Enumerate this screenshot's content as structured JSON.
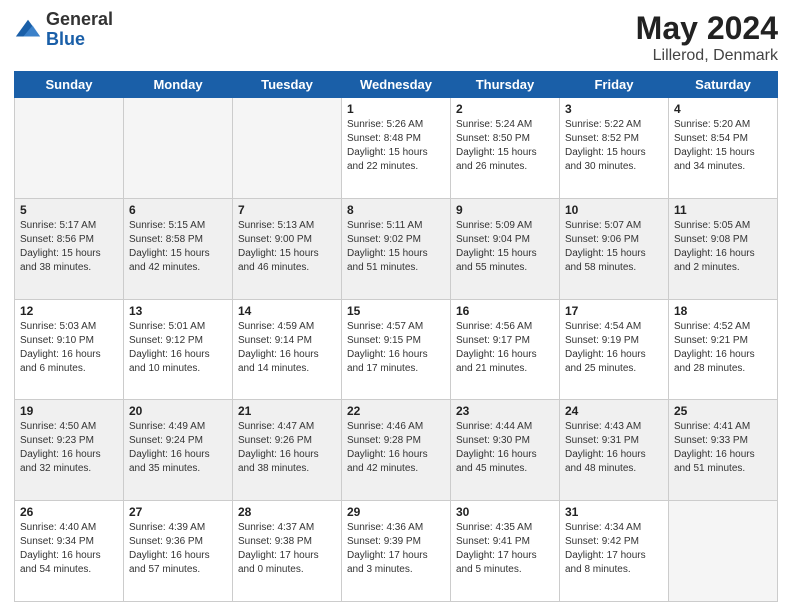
{
  "header": {
    "logo_general": "General",
    "logo_blue": "Blue",
    "title": "May 2024",
    "subtitle": "Lillerod, Denmark"
  },
  "days_of_week": [
    "Sunday",
    "Monday",
    "Tuesday",
    "Wednesday",
    "Thursday",
    "Friday",
    "Saturday"
  ],
  "weeks": [
    {
      "shade": false,
      "days": [
        {
          "num": "",
          "sunrise": "",
          "sunset": "",
          "daylight": "",
          "empty": true
        },
        {
          "num": "",
          "sunrise": "",
          "sunset": "",
          "daylight": "",
          "empty": true
        },
        {
          "num": "",
          "sunrise": "",
          "sunset": "",
          "daylight": "",
          "empty": true
        },
        {
          "num": "1",
          "sunrise": "Sunrise: 5:26 AM",
          "sunset": "Sunset: 8:48 PM",
          "daylight": "Daylight: 15 hours and 22 minutes."
        },
        {
          "num": "2",
          "sunrise": "Sunrise: 5:24 AM",
          "sunset": "Sunset: 8:50 PM",
          "daylight": "Daylight: 15 hours and 26 minutes."
        },
        {
          "num": "3",
          "sunrise": "Sunrise: 5:22 AM",
          "sunset": "Sunset: 8:52 PM",
          "daylight": "Daylight: 15 hours and 30 minutes."
        },
        {
          "num": "4",
          "sunrise": "Sunrise: 5:20 AM",
          "sunset": "Sunset: 8:54 PM",
          "daylight": "Daylight: 15 hours and 34 minutes."
        }
      ]
    },
    {
      "shade": true,
      "days": [
        {
          "num": "5",
          "sunrise": "Sunrise: 5:17 AM",
          "sunset": "Sunset: 8:56 PM",
          "daylight": "Daylight: 15 hours and 38 minutes."
        },
        {
          "num": "6",
          "sunrise": "Sunrise: 5:15 AM",
          "sunset": "Sunset: 8:58 PM",
          "daylight": "Daylight: 15 hours and 42 minutes."
        },
        {
          "num": "7",
          "sunrise": "Sunrise: 5:13 AM",
          "sunset": "Sunset: 9:00 PM",
          "daylight": "Daylight: 15 hours and 46 minutes."
        },
        {
          "num": "8",
          "sunrise": "Sunrise: 5:11 AM",
          "sunset": "Sunset: 9:02 PM",
          "daylight": "Daylight: 15 hours and 51 minutes."
        },
        {
          "num": "9",
          "sunrise": "Sunrise: 5:09 AM",
          "sunset": "Sunset: 9:04 PM",
          "daylight": "Daylight: 15 hours and 55 minutes."
        },
        {
          "num": "10",
          "sunrise": "Sunrise: 5:07 AM",
          "sunset": "Sunset: 9:06 PM",
          "daylight": "Daylight: 15 hours and 58 minutes."
        },
        {
          "num": "11",
          "sunrise": "Sunrise: 5:05 AM",
          "sunset": "Sunset: 9:08 PM",
          "daylight": "Daylight: 16 hours and 2 minutes."
        }
      ]
    },
    {
      "shade": false,
      "days": [
        {
          "num": "12",
          "sunrise": "Sunrise: 5:03 AM",
          "sunset": "Sunset: 9:10 PM",
          "daylight": "Daylight: 16 hours and 6 minutes."
        },
        {
          "num": "13",
          "sunrise": "Sunrise: 5:01 AM",
          "sunset": "Sunset: 9:12 PM",
          "daylight": "Daylight: 16 hours and 10 minutes."
        },
        {
          "num": "14",
          "sunrise": "Sunrise: 4:59 AM",
          "sunset": "Sunset: 9:14 PM",
          "daylight": "Daylight: 16 hours and 14 minutes."
        },
        {
          "num": "15",
          "sunrise": "Sunrise: 4:57 AM",
          "sunset": "Sunset: 9:15 PM",
          "daylight": "Daylight: 16 hours and 17 minutes."
        },
        {
          "num": "16",
          "sunrise": "Sunrise: 4:56 AM",
          "sunset": "Sunset: 9:17 PM",
          "daylight": "Daylight: 16 hours and 21 minutes."
        },
        {
          "num": "17",
          "sunrise": "Sunrise: 4:54 AM",
          "sunset": "Sunset: 9:19 PM",
          "daylight": "Daylight: 16 hours and 25 minutes."
        },
        {
          "num": "18",
          "sunrise": "Sunrise: 4:52 AM",
          "sunset": "Sunset: 9:21 PM",
          "daylight": "Daylight: 16 hours and 28 minutes."
        }
      ]
    },
    {
      "shade": true,
      "days": [
        {
          "num": "19",
          "sunrise": "Sunrise: 4:50 AM",
          "sunset": "Sunset: 9:23 PM",
          "daylight": "Daylight: 16 hours and 32 minutes."
        },
        {
          "num": "20",
          "sunrise": "Sunrise: 4:49 AM",
          "sunset": "Sunset: 9:24 PM",
          "daylight": "Daylight: 16 hours and 35 minutes."
        },
        {
          "num": "21",
          "sunrise": "Sunrise: 4:47 AM",
          "sunset": "Sunset: 9:26 PM",
          "daylight": "Daylight: 16 hours and 38 minutes."
        },
        {
          "num": "22",
          "sunrise": "Sunrise: 4:46 AM",
          "sunset": "Sunset: 9:28 PM",
          "daylight": "Daylight: 16 hours and 42 minutes."
        },
        {
          "num": "23",
          "sunrise": "Sunrise: 4:44 AM",
          "sunset": "Sunset: 9:30 PM",
          "daylight": "Daylight: 16 hours and 45 minutes."
        },
        {
          "num": "24",
          "sunrise": "Sunrise: 4:43 AM",
          "sunset": "Sunset: 9:31 PM",
          "daylight": "Daylight: 16 hours and 48 minutes."
        },
        {
          "num": "25",
          "sunrise": "Sunrise: 4:41 AM",
          "sunset": "Sunset: 9:33 PM",
          "daylight": "Daylight: 16 hours and 51 minutes."
        }
      ]
    },
    {
      "shade": false,
      "days": [
        {
          "num": "26",
          "sunrise": "Sunrise: 4:40 AM",
          "sunset": "Sunset: 9:34 PM",
          "daylight": "Daylight: 16 hours and 54 minutes."
        },
        {
          "num": "27",
          "sunrise": "Sunrise: 4:39 AM",
          "sunset": "Sunset: 9:36 PM",
          "daylight": "Daylight: 16 hours and 57 minutes."
        },
        {
          "num": "28",
          "sunrise": "Sunrise: 4:37 AM",
          "sunset": "Sunset: 9:38 PM",
          "daylight": "Daylight: 17 hours and 0 minutes."
        },
        {
          "num": "29",
          "sunrise": "Sunrise: 4:36 AM",
          "sunset": "Sunset: 9:39 PM",
          "daylight": "Daylight: 17 hours and 3 minutes."
        },
        {
          "num": "30",
          "sunrise": "Sunrise: 4:35 AM",
          "sunset": "Sunset: 9:41 PM",
          "daylight": "Daylight: 17 hours and 5 minutes."
        },
        {
          "num": "31",
          "sunrise": "Sunrise: 4:34 AM",
          "sunset": "Sunset: 9:42 PM",
          "daylight": "Daylight: 17 hours and 8 minutes."
        },
        {
          "num": "",
          "sunrise": "",
          "sunset": "",
          "daylight": "",
          "empty": true
        }
      ]
    }
  ]
}
